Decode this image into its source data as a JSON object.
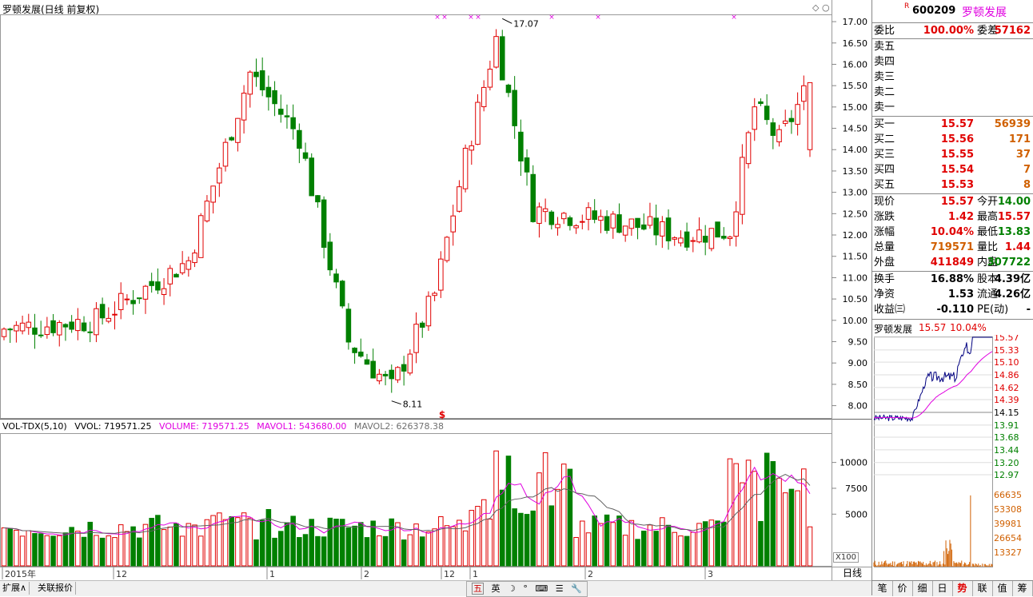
{
  "chart": {
    "title": "罗顿发展(日线 前复权)",
    "price_ticks": [
      "17.00",
      "16.50",
      "16.00",
      "15.50",
      "15.00",
      "14.50",
      "14.00",
      "13.50",
      "13.00",
      "12.50",
      "12.00",
      "11.50",
      "11.00",
      "10.50",
      "10.00",
      "9.50",
      "9.00",
      "8.50",
      "8.00"
    ],
    "high_annotation": "17.07",
    "low_annotation": "8.11",
    "signal_marker": "$",
    "vol_legend": {
      "name": "VOL-TDX(5,10)",
      "vvol": "VVOL: 719571.25",
      "volume": "VOLUME: 719571.25",
      "mavol1": "MAVOL1: 543680.00",
      "mavol2": "MAVOL2: 626378.38"
    },
    "vol_ticks": [
      "10000",
      "7500",
      "5000"
    ],
    "x100_label": "X100",
    "period": "日线",
    "date_labels": [
      "2015年",
      "12",
      "1",
      "2",
      "12",
      "1",
      "2",
      "3"
    ],
    "colors": {
      "up": "#e00000",
      "down": "#008000",
      "ma1": "#e000e0",
      "ma2": "#606060"
    }
  },
  "bottom_bar": {
    "expand": "扩展∧",
    "related": "关联报价",
    "ime": [
      "五",
      "英",
      "☽",
      "°",
      "⌨",
      "☰",
      "🔧"
    ]
  },
  "panel": {
    "badge": "R",
    "code": "600209",
    "name": "罗顿发展",
    "weibi_label": "委比",
    "weibi": "100.00%",
    "weicha_label": "委差",
    "weicha": "57162",
    "sell": [
      {
        "label": "卖五",
        "price": "",
        "vol": ""
      },
      {
        "label": "卖四",
        "price": "",
        "vol": ""
      },
      {
        "label": "卖三",
        "price": "",
        "vol": ""
      },
      {
        "label": "卖二",
        "price": "",
        "vol": ""
      },
      {
        "label": "卖一",
        "price": "",
        "vol": ""
      }
    ],
    "buy": [
      {
        "label": "买一",
        "price": "15.57",
        "vol": "56939"
      },
      {
        "label": "买二",
        "price": "15.56",
        "vol": "171"
      },
      {
        "label": "买三",
        "price": "15.55",
        "vol": "37"
      },
      {
        "label": "买四",
        "price": "15.54",
        "vol": "7"
      },
      {
        "label": "买五",
        "price": "15.53",
        "vol": "8"
      }
    ],
    "quote": [
      {
        "l1": "现价",
        "v1": "15.57",
        "c1": "red",
        "l2": "今开",
        "v2": "14.00",
        "c2": "green"
      },
      {
        "l1": "涨跌",
        "v1": "1.42",
        "c1": "red",
        "l2": "最高",
        "v2": "15.57",
        "c2": "red"
      },
      {
        "l1": "涨幅",
        "v1": "10.04%",
        "c1": "red",
        "l2": "最低",
        "v2": "13.83",
        "c2": "green"
      },
      {
        "l1": "总量",
        "v1": "719571",
        "c1": "orange",
        "l2": "量比",
        "v2": "1.44",
        "c2": "red"
      },
      {
        "l1": "外盘",
        "v1": "411849",
        "c1": "red",
        "l2": "内盘",
        "v2": "307722",
        "c2": "green"
      }
    ],
    "fundamentals": [
      {
        "l1": "换手",
        "v1": "16.88%",
        "l2": "股本",
        "v2": "4.39亿"
      },
      {
        "l1": "净资",
        "v1": "1.53",
        "l2": "流通",
        "v2": "4.26亿"
      },
      {
        "l1": "收益㈢",
        "v1": "-0.110",
        "l2": "PE(动)",
        "v2": "-"
      }
    ],
    "mini": {
      "name": "罗顿发展",
      "price": "15.57",
      "change": "10.04%",
      "price_ticks": [
        "15.57",
        "15.33",
        "15.10",
        "14.86",
        "14.62",
        "14.39",
        "14.15",
        "13.91",
        "13.68",
        "13.44",
        "13.20",
        "12.97"
      ],
      "vol_ticks": [
        "66635",
        "53308",
        "39981",
        "26654",
        "13327"
      ]
    },
    "tabs": [
      "笔",
      "价",
      "细",
      "日",
      "势",
      "联",
      "值",
      "筹"
    ],
    "active_tab": "势"
  }
}
